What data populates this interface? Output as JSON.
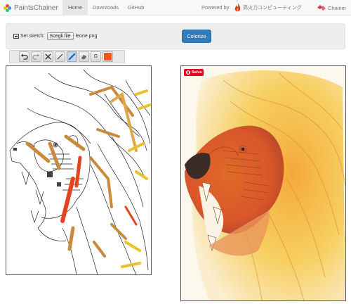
{
  "navbar": {
    "brand": "PaintsChainer",
    "tabs": [
      {
        "label": "Home",
        "active": true
      },
      {
        "label": "Downloads",
        "active": false
      },
      {
        "label": "GitHub",
        "active": false
      }
    ],
    "powered_by": "Powered by",
    "partner_name": "高火力コンピューティング",
    "chainer_label": "Chainer"
  },
  "sketch_panel": {
    "set_sketch_label": "Set sketch:",
    "file_button_label": "Scegli file",
    "file_name": "leone.png",
    "colorize_label": "Colorize"
  },
  "toolbar": {
    "tools": [
      "undo-icon",
      "redo-icon",
      "clear-icon",
      "pen-icon",
      "brush-icon",
      "eraser-icon",
      "grayscale-icon",
      "color-picker"
    ],
    "grayscale_label": "G",
    "selected_color": "#f05a1a"
  },
  "result": {
    "save_label": "Salva"
  },
  "colors": {
    "accent": "#337ab7",
    "pinterest": "#e60023"
  }
}
